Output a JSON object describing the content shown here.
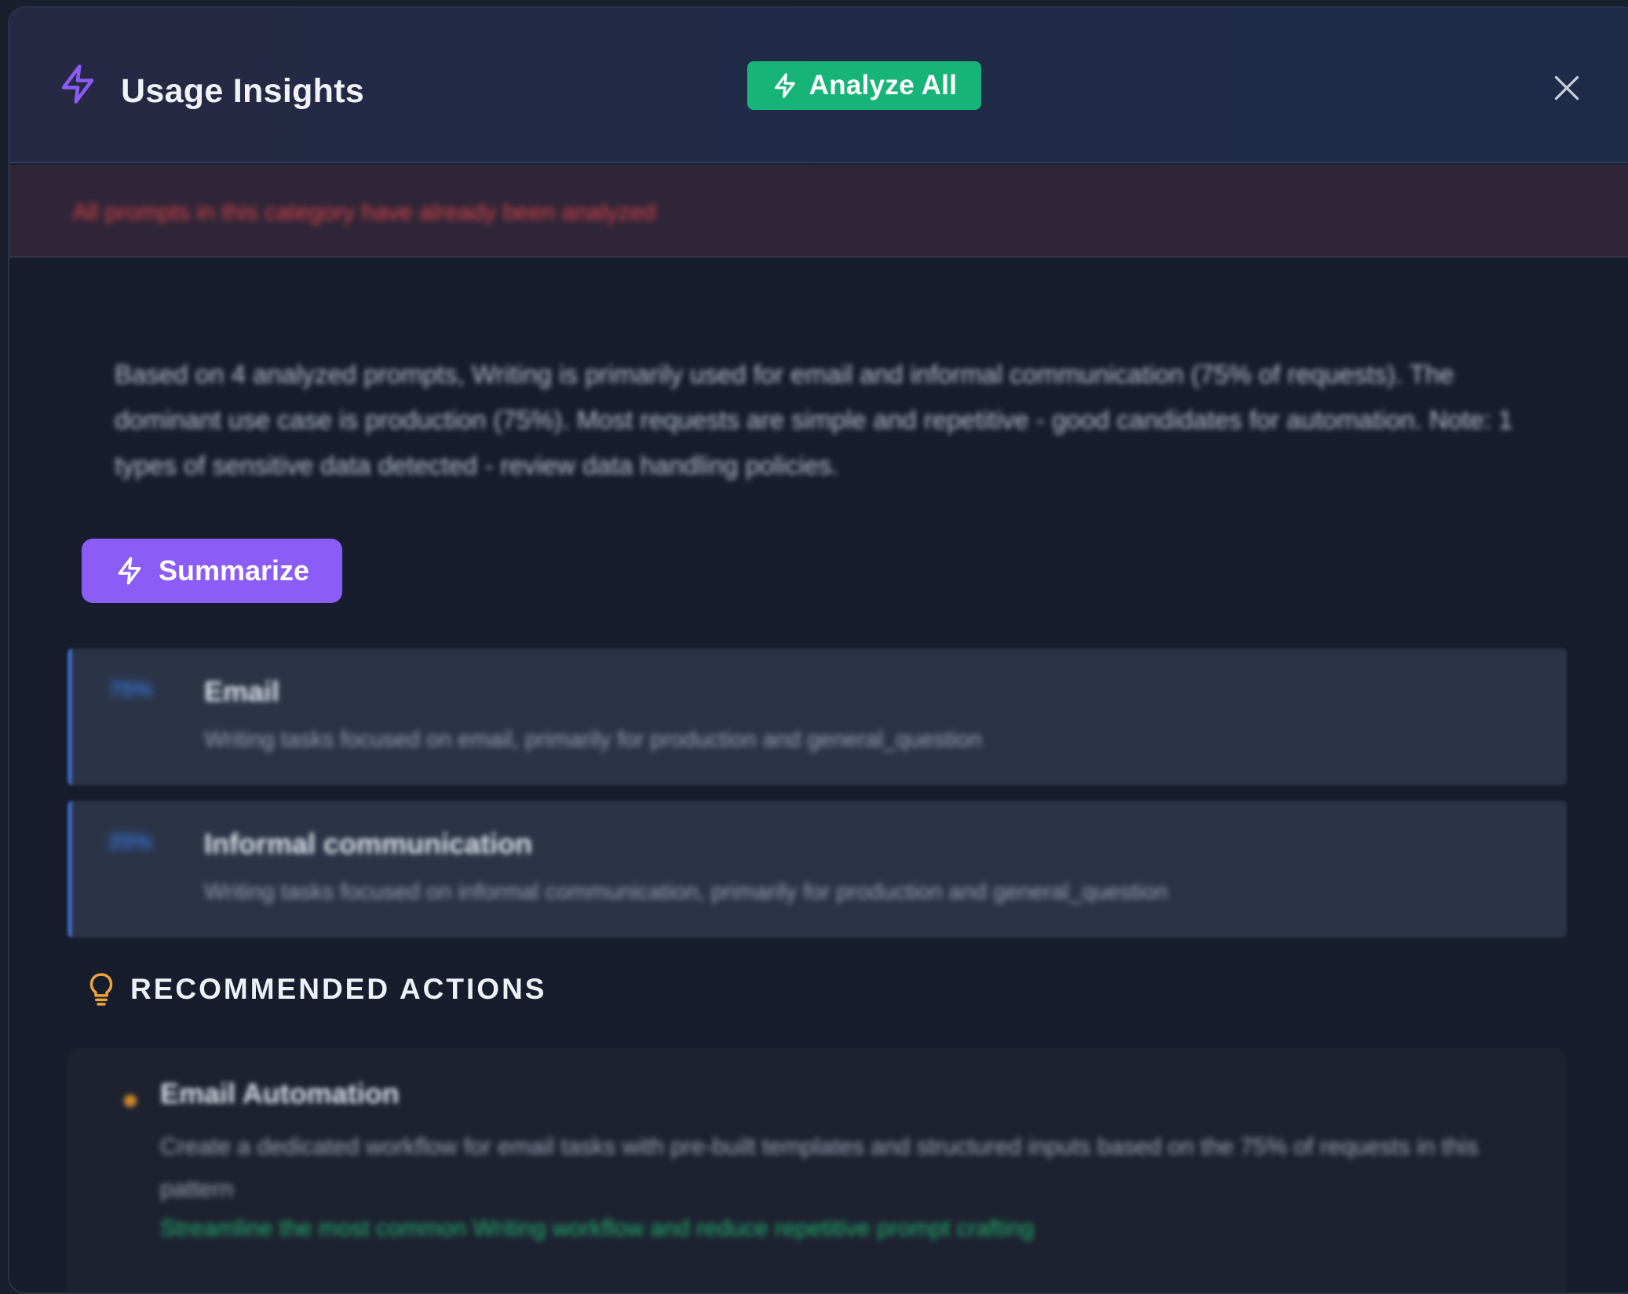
{
  "header": {
    "title": "Usage Insights",
    "analyze_label": "Analyze All",
    "icons": {
      "title": "lightning-icon",
      "analyze": "lightning-icon",
      "close": "close-icon"
    }
  },
  "alert": {
    "message": "All prompts in this category have already been analyzed"
  },
  "summary": {
    "text": "Based on 4 analyzed prompts, Writing is primarily used for email and informal communication (75% of requests). The dominant use case is production (75%). Most requests are simple and repetitive - good candidates for automation. Note: 1 types of sensitive data detected - review data handling policies."
  },
  "summarize_button": {
    "label": "Summarize",
    "icon": "lightning-icon"
  },
  "patterns": [
    {
      "percent": "75%",
      "title": "Email",
      "description": "Writing tasks focused on email, primarily for production and general_question"
    },
    {
      "percent": "25%",
      "title": "Informal communication",
      "description": "Writing tasks focused on informal communication, primarily for production and general_question"
    }
  ],
  "recommended": {
    "heading": "RECOMMENDED ACTIONS",
    "icon": "lightbulb-icon",
    "actions": [
      {
        "title": "Email Automation",
        "description": "Create a dedicated workflow for email tasks with pre-built templates and structured inputs based on the 75% of requests in this pattern",
        "impact": "Streamline the most common Writing workflow and reduce repetitive prompt crafting"
      }
    ]
  },
  "colors": {
    "accent_purple": "#8b5cf6",
    "accent_green": "#16b479",
    "alert_red": "#d9434b",
    "pattern_blue": "#3b66b8",
    "warning_amber": "#f0a53a"
  }
}
